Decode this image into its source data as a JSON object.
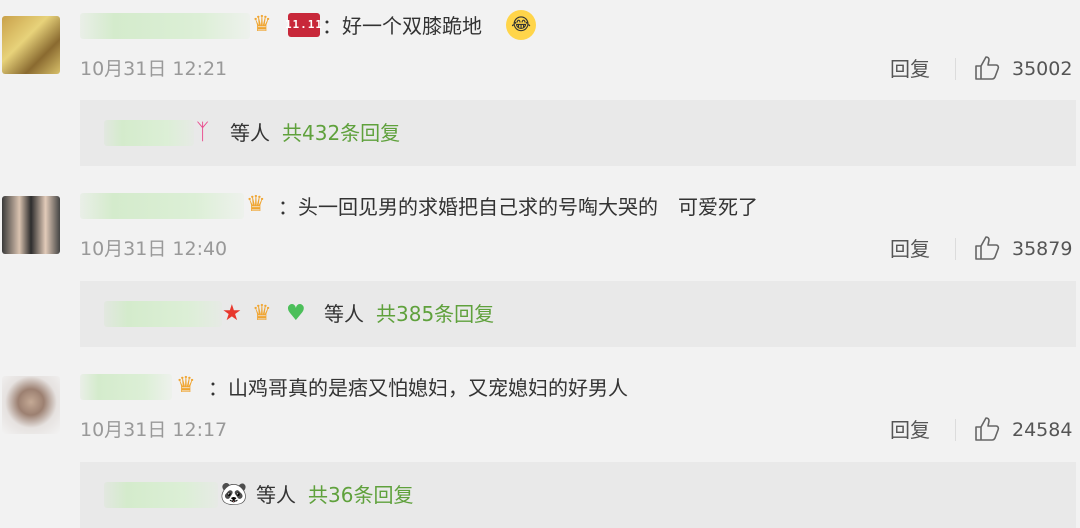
{
  "comments": [
    {
      "comment_text": "：好一个双膝跪地",
      "badges": [
        "crown-icon",
        "vip-badge",
        "laugh-cry-emoji"
      ],
      "vip_label": "11.11",
      "emoji": "😂",
      "time": "10月31日 12:21",
      "reply_label": "回复",
      "likes": "35002",
      "replies": {
        "deng": "等人",
        "total": "共432条回复",
        "badge_icon": "butterfly-icon"
      }
    },
    {
      "comment_text": "：头一回见男的求婚把自己求的号啕大哭的　可爱死了",
      "badges": [
        "crown-icon"
      ],
      "time": "10月31日 12:40",
      "reply_label": "回复",
      "likes": "35879",
      "replies": {
        "deng": "等人",
        "total": "共385条回复",
        "badge_icon": "star-icon"
      }
    },
    {
      "comment_text": "：山鸡哥真的是痞又怕媳妇，又宠媳妇的好男人",
      "badges": [
        "crown-icon"
      ],
      "time": "10月31日 12:17",
      "reply_label": "回复",
      "likes": "24584",
      "replies": {
        "deng": "等人",
        "total": "共36条回复",
        "badge_icon": "panda-icon"
      }
    }
  ],
  "colors": {
    "background": "#f2f2f2",
    "reply_box": "#e9e9e9",
    "reply_count": "#5fa13c",
    "time": "#999999"
  }
}
